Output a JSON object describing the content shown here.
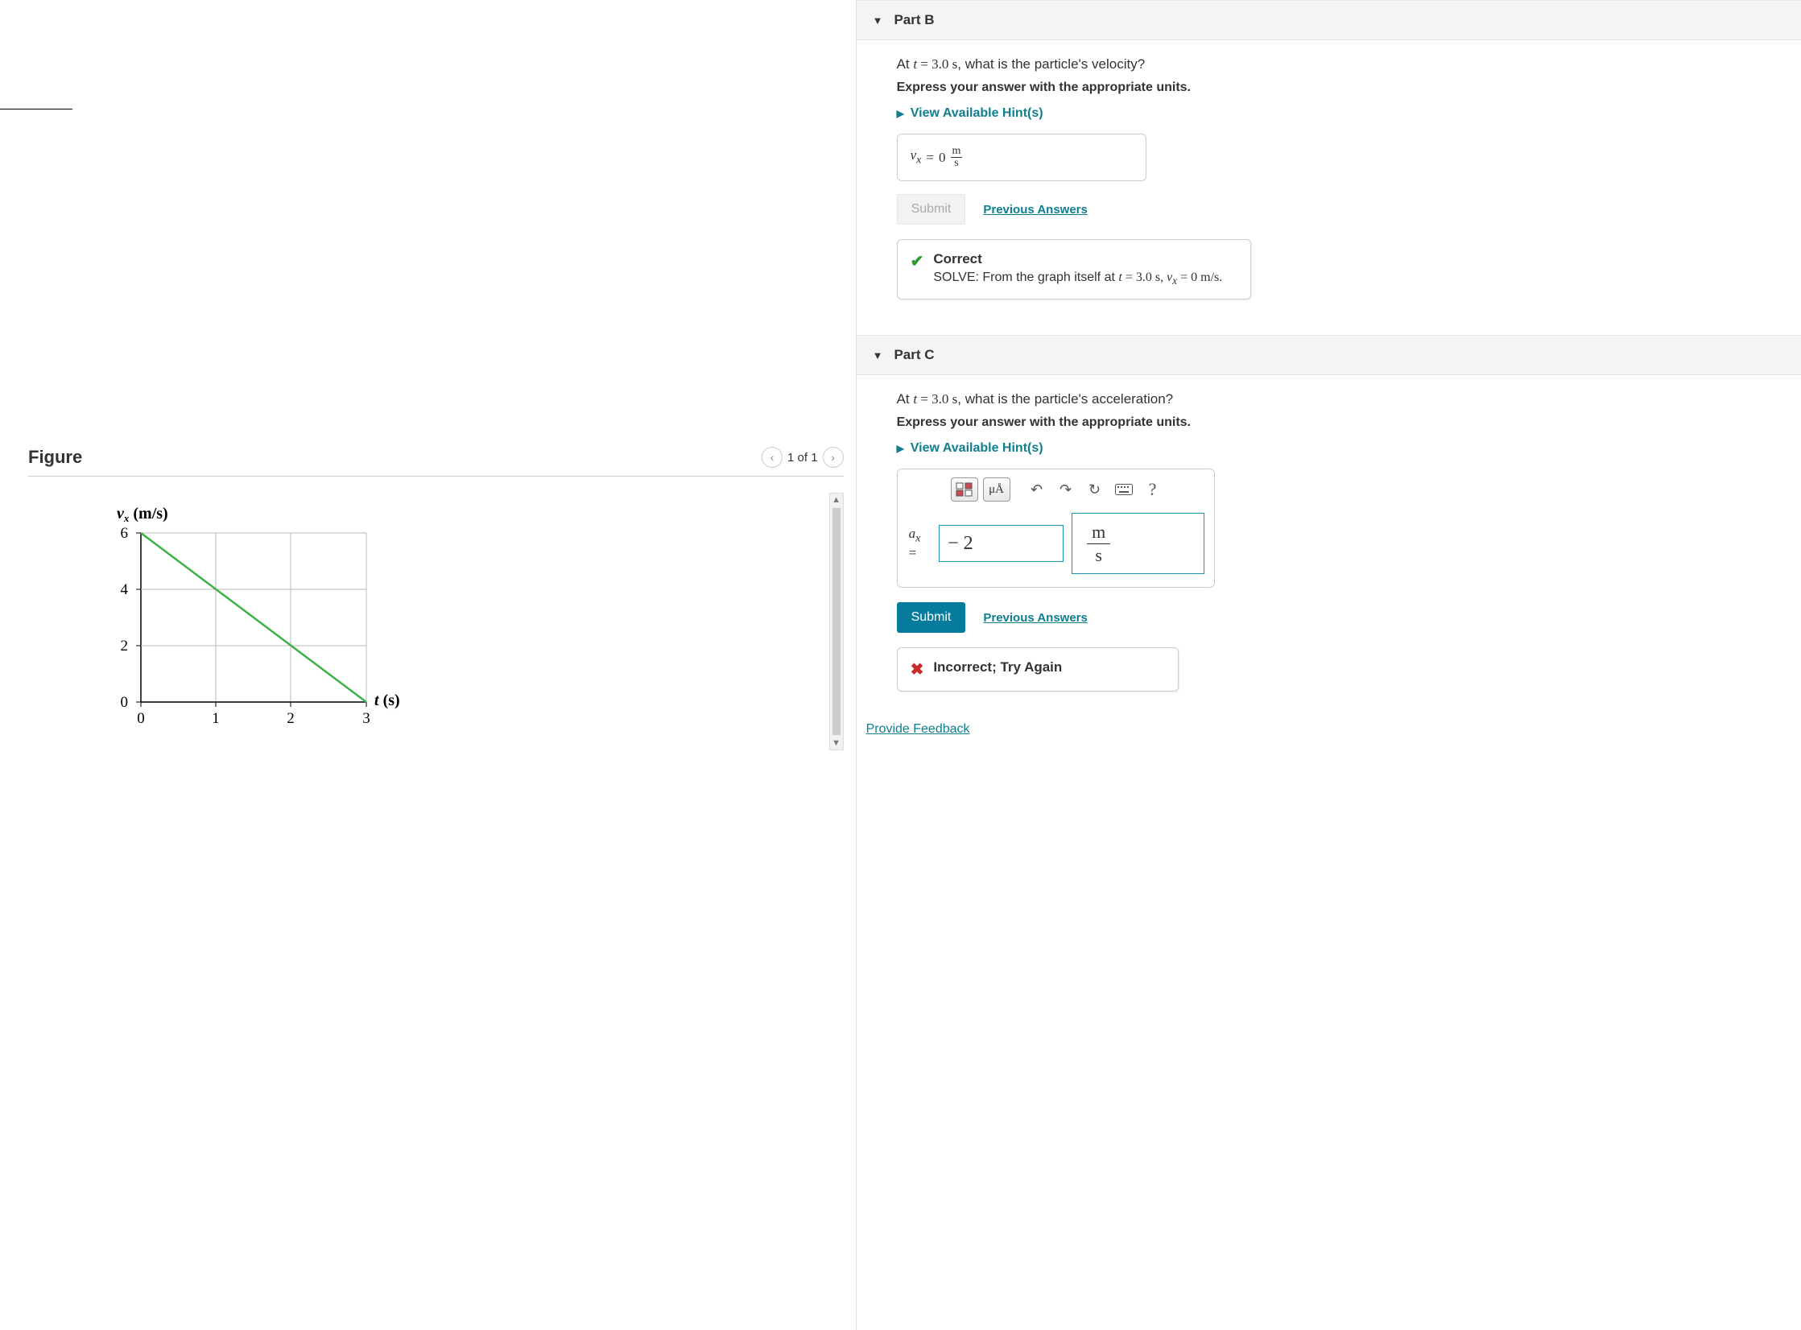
{
  "figure": {
    "title": "Figure",
    "nav_prev_glyph": "‹",
    "page_text": "1 of 1",
    "nav_next_glyph": "›"
  },
  "chart_data": {
    "type": "line",
    "title": "",
    "xlabel": "t (s)",
    "ylabel": "v_x (m/s)",
    "xlim": [
      0,
      3
    ],
    "ylim": [
      0,
      6
    ],
    "x_ticks": [
      0,
      1,
      2,
      3
    ],
    "y_ticks": [
      0,
      2,
      4,
      6
    ],
    "series": [
      {
        "name": "v_x",
        "x": [
          0,
          3
        ],
        "y": [
          6,
          0
        ],
        "color": "#3bb24a"
      }
    ]
  },
  "partB": {
    "title": "Part B",
    "question_prefix": "At ",
    "question_t": "t",
    "question_eq": " = 3.0 s",
    "question_suffix": ", what is the particle's velocity?",
    "instr": "Express your answer with the appropriate units.",
    "hints_label": "View Available Hint(s)",
    "var_html": "v_x",
    "answer_value": "0",
    "unit_num": "m",
    "unit_den": "s",
    "submit_label": "Submit",
    "prev_answers_label": "Previous Answers",
    "feedback_title": "Correct",
    "feedback_body_prefix": "SOLVE: From the graph itself at ",
    "feedback_body_suffix": " = 0 m/s.",
    "feedback_t": "t",
    "feedback_teq": " = 3.0 s, ",
    "feedback_v": "v_x"
  },
  "partC": {
    "title": "Part C",
    "question_prefix": "At ",
    "question_t": "t",
    "question_eq": " = 3.0 s",
    "question_suffix": ", what is the particle's acceleration?",
    "instr": "Express your answer with the appropriate units.",
    "hints_label": "View Available Hint(s)",
    "toolbar": {
      "templates": "templates",
      "units": "μÅ",
      "undo": "↶",
      "redo": "↷",
      "reset": "↻",
      "keyboard": "⌨",
      "help": "?"
    },
    "var_label": "a_x",
    "value": "− 2",
    "unit_top": "m",
    "unit_bot": "s",
    "submit_label": "Submit",
    "prev_answers_label": "Previous Answers",
    "feedback_title": "Incorrect; Try Again"
  },
  "links": {
    "provide_feedback": "Provide Feedback"
  }
}
